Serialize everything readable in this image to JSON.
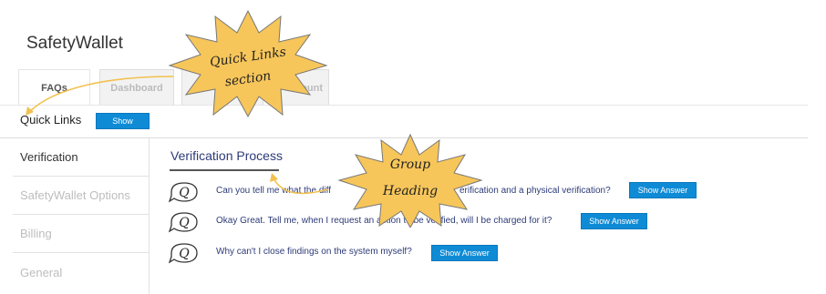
{
  "app": {
    "title": "SafetyWallet"
  },
  "tabs": [
    {
      "label": "FAQs"
    },
    {
      "label": "Dashboard"
    },
    {
      "label": ""
    },
    {
      "label": "ount"
    }
  ],
  "quick_links": {
    "label": "Quick Links",
    "show_label": "Show"
  },
  "sidebar": {
    "items": [
      {
        "label": "Verification"
      },
      {
        "label": "SafetyWallet Options"
      },
      {
        "label": "Billing"
      },
      {
        "label": "General"
      }
    ]
  },
  "main": {
    "group_heading": "Verification Process",
    "faqs": [
      {
        "question": "Can you tell me what the diff",
        "question_end": "erification and a physical verification?",
        "button": "Show Answer"
      },
      {
        "question": "Okay Great. Tell me, when I request an action to be verified, will I be charged for it?",
        "button": "Show Answer"
      },
      {
        "question": "Why can't I close findings on the system myself?",
        "button": "Show Answer"
      }
    ]
  },
  "callouts": {
    "quick_links": [
      "Quick Links",
      "section"
    ],
    "group": [
      "Group",
      "Heading"
    ]
  },
  "colors": {
    "button": "#0f8bd6",
    "heading": "#2d3b78",
    "callout_fill": "#f7c65a"
  },
  "icons": [
    "q-bubble-icon",
    "arrow-icon"
  ]
}
